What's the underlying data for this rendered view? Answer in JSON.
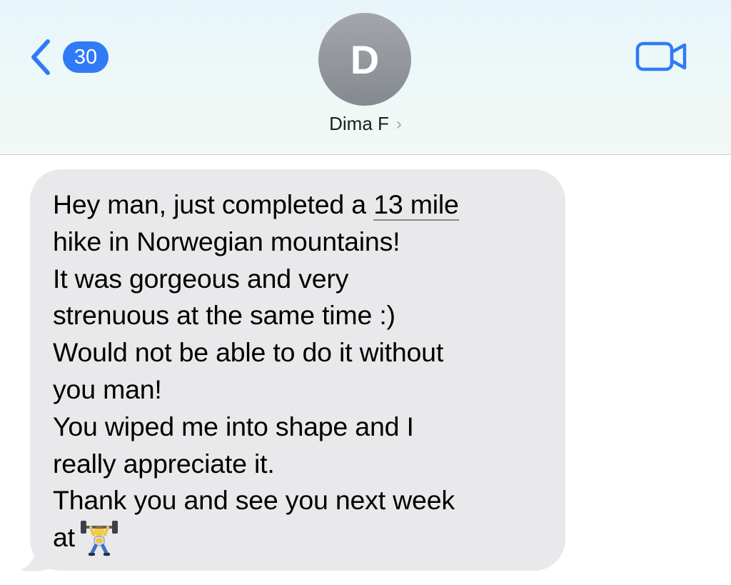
{
  "header": {
    "back_badge_count": "30",
    "avatar_initial": "D",
    "contact_name": "Dima F",
    "name_chevron": "›",
    "back_icon": "chevron-left-icon",
    "video_icon": "video-camera-icon",
    "accent_color": "#2f7bf5"
  },
  "message": {
    "direction": "incoming",
    "bubble_color": "#e9e9eb",
    "lines": [
      {
        "before": "Hey man, just completed a ",
        "link": "13 mile",
        "after": ""
      },
      {
        "text": "hike in Norwegian mountains!"
      },
      {
        "text": "It was gorgeous and very"
      },
      {
        "text": "strenuous at the same time :)"
      },
      {
        "text": "Would not be able to do it without"
      },
      {
        "text": "you man!"
      },
      {
        "text": "You wiped me into shape and I"
      },
      {
        "text": "really appreciate it."
      },
      {
        "text": "Thank you and see you next week"
      },
      {
        "text": "at",
        "emoji": "weightlifter-emoji"
      }
    ]
  }
}
